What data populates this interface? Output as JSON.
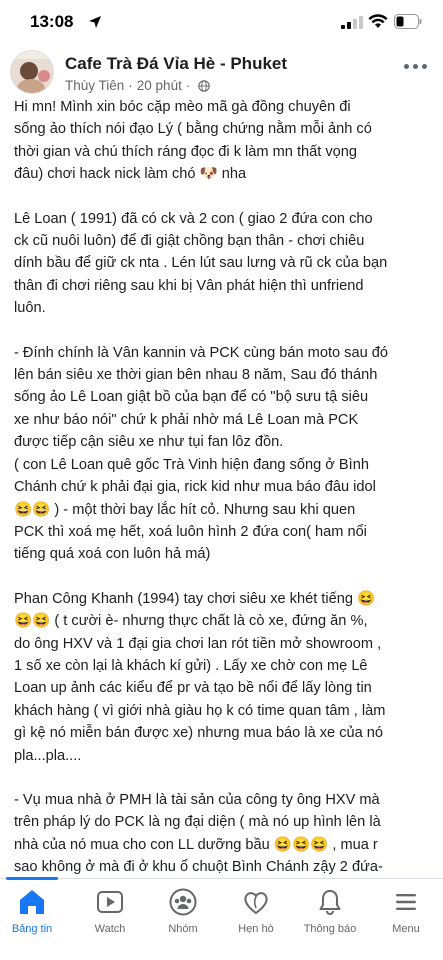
{
  "status_bar": {
    "time": "13:08"
  },
  "post": {
    "group_name": "Cafe Trà Đá Vỉa Hè - Phuket",
    "author": "Thùy Tiên",
    "time_ago": "20 phút",
    "meta_separator": "·",
    "paragraphs": [
      "Hi mn! Mình xin bóc cặp mèo mã gà đồng chuyên đi\nsống ảo thích nói đạo Lý  ( bằng chứng nằm mỗi ảnh có\nthời gian và chú thích ráng đọc đi k làm mn thất vọng\nđâu) chơi hack nick làm chó 🐶 nha",
      "Lê Loan ( 1991)  đã có ck và 2 con ( giao 2 đứa con cho\nck cũ nuôi luôn) để  đi giật chồng bạn thân - chơi chiêu\ndính bầu để giữ ck nta . Lén lút sau lưng và rũ ck của bạn\nthân đi chơi riêng sau khi bị Vân phát hiện thì unfriend\nluôn.",
      "- Đính chính là Vân kannin và PCK cùng bán moto sau đó\nlên bán siêu xe thời gian bên nhau 8 năm,  Sau đó thánh\nsống ảo Lê Loan giật bồ của bạn để có  \"bộ sưu tậ siêu\nxe như báo nói\"  chứ k phải nhờ má Lê Loan mà PCK\nđược tiếp cận siêu xe như tụi fan lôz đồn.\n( con Lê Loan quê gốc Trà Vinh hiện đang sống ở Bình\nChánh chứ k phải đại gia, rick kid như mua báo đâu  idol\n😆😆 ) - một thời bay lắc hít cỏ. Nhưng sau khi quen\nPCK thì xoá mẹ hết, xoá luôn hình 2 đứa con( ham nổi\ntiếng quá xoá con luôn hả má)",
      "Phan Công Khanh (1994)  tay chơi siêu xe khét tiếng 😆\n😆😆 ( t cười è-  nhưng thực chất là cò xe, đứng ăn %,\ndo ông HXV và 1 đại gia chơi lan rót tiền mở showroom ,\n 1 số xe còn lại  là  khách kí gửi) . Lấy xe chờ con mẹ Lê\nLoan up ảnh các kiểu để pr và tạo bề nổi  để lấy lòng tin\nkhách hàng ( vì giới nhà giàu họ k có time quan tâm , làm\ngì kệ nó miễn bán được xe)  nhưng mua báo là xe của nó\npla...pla....",
      "- Vụ mua nhà ở PMH  là tài sản của công ty ông HXV mà\ntrên pháp lý do PCK là ng đại diện ( mà nó up hình lên là\nnhà của nó mua cho con LL dưỡng bầu 😆😆😆 , mua r\nsao không ở mà đi ở khu ổ chuột Bình Chánh zậy 2 đứa-"
    ]
  },
  "bottom_nav": {
    "items": [
      {
        "label": "Bảng tin",
        "icon": "home-icon",
        "active": true
      },
      {
        "label": "Watch",
        "icon": "watch-icon",
        "active": false
      },
      {
        "label": "Nhóm",
        "icon": "groups-icon",
        "active": false
      },
      {
        "label": "Hẹn hò",
        "icon": "dating-icon",
        "active": false
      },
      {
        "label": "Thông báo",
        "icon": "bell-icon",
        "active": false
      },
      {
        "label": "Menu",
        "icon": "menu-icon",
        "active": false
      }
    ]
  },
  "colors": {
    "accent": "#1877f2",
    "secondary_text": "#65676b",
    "primary_text": "#1c1e21"
  }
}
